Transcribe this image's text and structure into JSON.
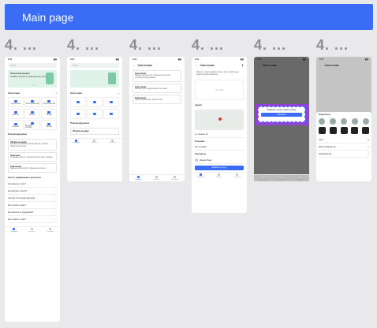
{
  "header": {
    "title": "Main page"
  },
  "sections": [
    "4. ...",
    "4. ...",
    "4. ...",
    "4. ...",
    "4. ...",
    "4. ..."
  ],
  "status": {
    "time": "9:41"
  },
  "s1": {
    "search_placeholder": "Поиск",
    "promo_title": "Полезный раздел",
    "promo_text": "Узнайте больше о возможностях приложения",
    "categories_title": "Категории",
    "cat_items": [
      "Сантехника",
      "Электромонтаж",
      "Строительство",
      "Мебель",
      "Ремонт",
      "Уборка",
      "Клининг",
      "Бытовая техника",
      "Прочее"
    ],
    "reco_title": "Рекомендуемые",
    "cards": [
      {
        "title": "Уборка на дому",
        "text": "Профессиональная уборка квартир и домов. Гарантия качества."
      },
      {
        "title": "Электрик",
        "text": "Установка розеток, выключателей и светильников."
      },
      {
        "title": "Сантехник",
        "text": "Замена смесителей, устранение протечек."
      }
    ],
    "faq_title": "Часто задаваемые вопросы",
    "faq_items": [
      "Как заказать услугу?",
      "Как работает оплата?",
      "Сколько стоит выезд мастера?",
      "Как отменить заказ?",
      "Как связаться с поддержкой?",
      "Как оставить отзыв?"
    ]
  },
  "s2": {
    "search_placeholder": "Поиск",
    "categories_title": "Категории",
    "reco_title": "Рекомендуемые",
    "card_title": "Уборка на дому"
  },
  "s3": {
    "nav_title": "Сантехник",
    "cards": [
      {
        "title": "Сантехник",
        "text": "Замена смесителей, устранение протечек, установка оборудования."
      },
      {
        "title": "Сантехник",
        "text": "Монтаж труб и радиаторов отопления."
      },
      {
        "title": "Сантехник",
        "text": "Прочистка засоров, диагностика."
      }
    ]
  },
  "s4": {
    "nav_title": "Сантехник",
    "text": "Мастер с опытом работы более 10 лет. Выполняет работы любой сложности.",
    "empty": "Нет фото",
    "map_title": "Адрес",
    "address": "ул. Ленина, 10",
    "reviews_title": "Отзывы",
    "rating_label": "Нет отзывов",
    "contacts_title": "Контакты",
    "person": "Иванов Иван",
    "button": "Заказать услугу"
  },
  "s5": {
    "nav_title": "Сантехник",
    "highlight_text": "Закажите услугу прямо сейчас",
    "highlight_button": "Заказать"
  },
  "s6": {
    "nav_title": "Сантехник",
    "sheet_title": "Поделиться",
    "share_rows": [
      "Copy",
      "Add to Reading List",
      "Add Bookmark"
    ]
  },
  "tabs": [
    "Главная",
    "Заказы",
    "Профиль"
  ]
}
